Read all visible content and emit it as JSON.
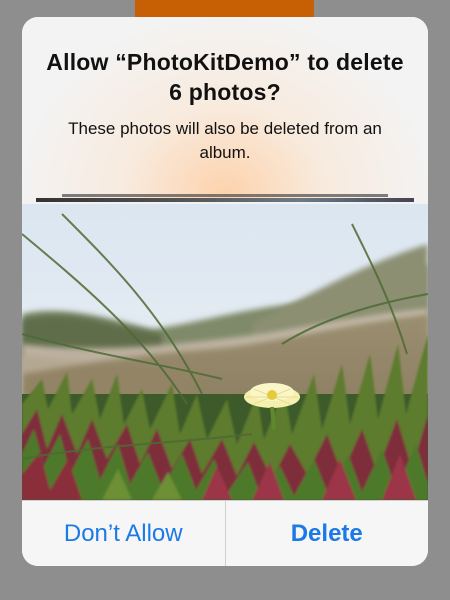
{
  "alert": {
    "title": "Allow “PhotoKitDemo” to delete 6 photos?",
    "message": "These photos will also be deleted from an album.",
    "photo_icon": "succulent-flower-photo",
    "buttons": {
      "cancel_label": "Don’t Allow",
      "confirm_label": "Delete"
    }
  },
  "colors": {
    "accent": "#1b7ae6",
    "background_strip": "#c75f05",
    "overlay": "#8e8e8e"
  }
}
